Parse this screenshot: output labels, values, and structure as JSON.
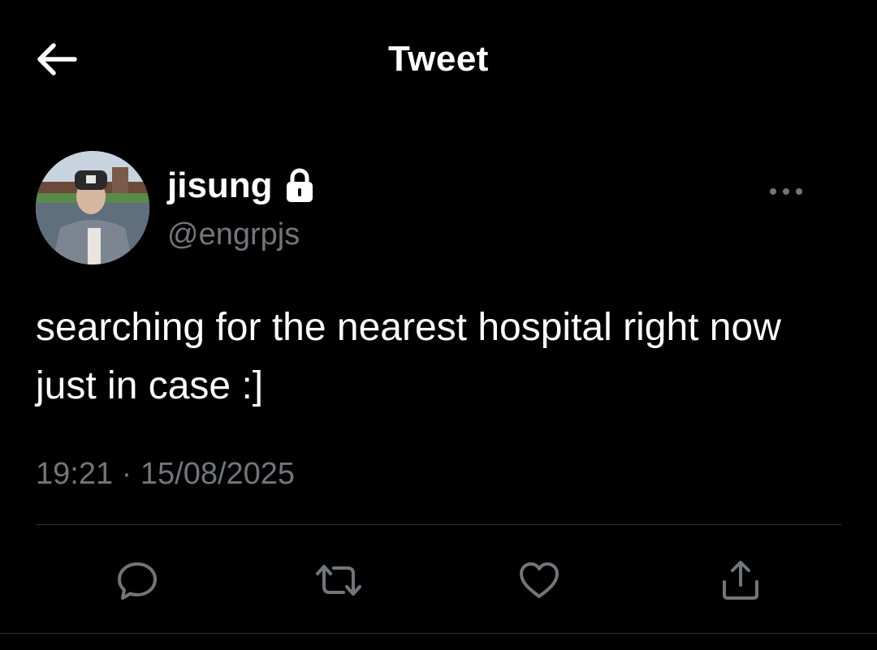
{
  "header": {
    "back_icon": "arrow-left-icon",
    "title": "Tweet"
  },
  "author": {
    "display_name": "jisung",
    "protected_icon": "lock-icon",
    "handle": "@engrpjs",
    "more_icon": "ellipsis-icon"
  },
  "tweet": {
    "text": "searching for the nearest hospital right now just in case :]",
    "time": "19:21",
    "separator": "·",
    "date": "15/08/2025"
  },
  "actions": [
    {
      "name": "reply",
      "icon": "comment-icon"
    },
    {
      "name": "retweet",
      "icon": "retweet-icon"
    },
    {
      "name": "like",
      "icon": "heart-icon"
    },
    {
      "name": "share",
      "icon": "share-icon"
    }
  ],
  "colors": {
    "background": "#000000",
    "text": "#ffffff",
    "secondary_text": "#71767b",
    "divider": "#2f3336"
  }
}
